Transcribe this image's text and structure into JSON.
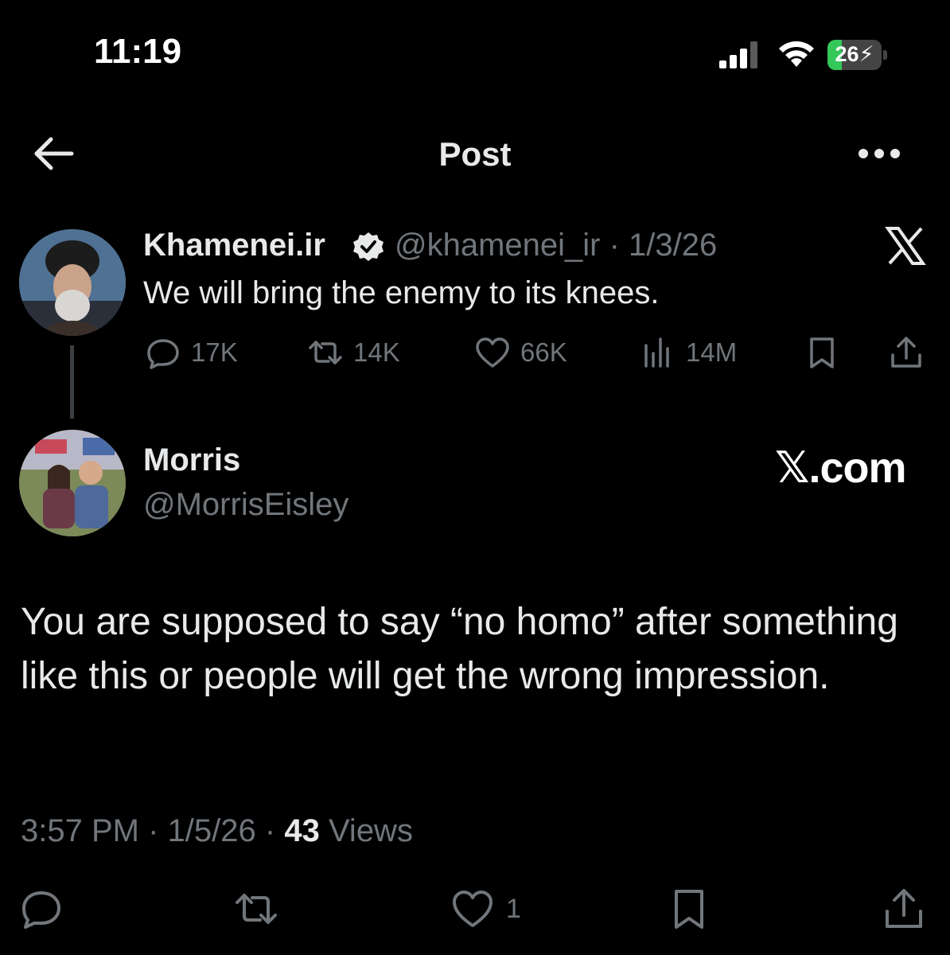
{
  "status_bar": {
    "time": "11:19",
    "battery_level": "26",
    "battery_fraction": 0.26,
    "colors": {
      "battery_fill": "#34c759"
    }
  },
  "header": {
    "title": "Post",
    "back_icon": "arrow-left-icon",
    "more_icon": "ellipsis-icon"
  },
  "quoted_post": {
    "author_name": "Khamenei.ir",
    "verified_icon": "verified-badge-icon",
    "handle_date": "@khamenei_ir · 1/3/26",
    "text": "We will bring the enemy to its knees.",
    "stats": {
      "replies": "17K",
      "reposts": "14K",
      "likes": "66K",
      "views": "14M"
    },
    "source_icon": "x-logo-icon"
  },
  "post": {
    "author_name": "Morris",
    "handle": "@MorrisEisley",
    "watermark": "𝕏.com",
    "text": "You are supposed to say “no homo” after something like this or people will get the wrong impression.",
    "time": "3:57 PM",
    "date": "1/5/26",
    "views_count": "43",
    "views_label": "Views",
    "separator": "·",
    "likes": "1"
  },
  "colors": {
    "background": "#000000",
    "text_primary": "#e7e9ea",
    "text_secondary": "#71767b"
  }
}
